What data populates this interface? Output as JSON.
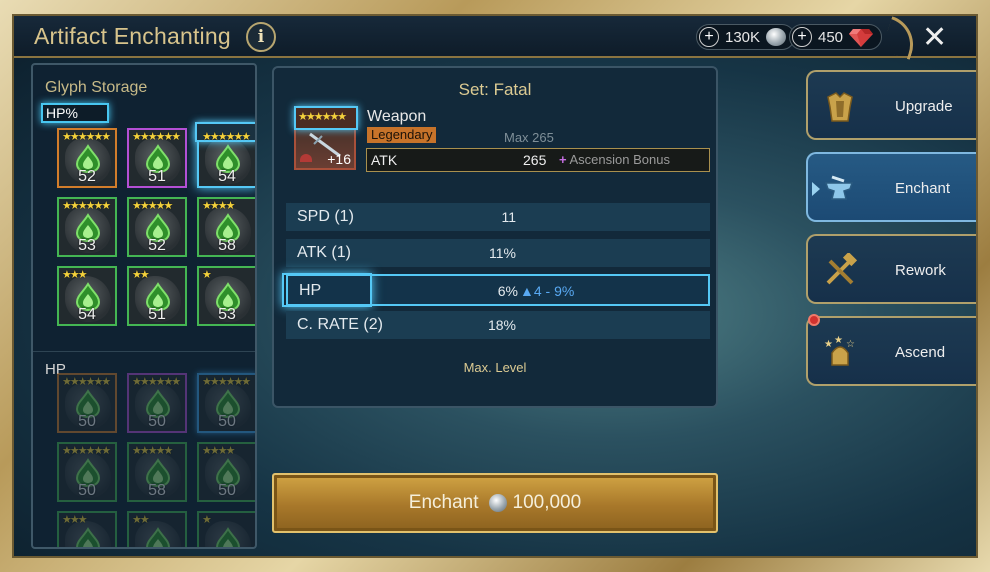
{
  "header": {
    "title": "Artifact Enchanting",
    "info_label": "i",
    "silver_amount": "130K",
    "gem_amount": "450",
    "close_label": "✕"
  },
  "glyph_storage": {
    "title": "Glyph Storage",
    "active_filter": "HP%",
    "hp_percent_glyphs": [
      {
        "level": "52",
        "stars": 6,
        "rarity": "orange"
      },
      {
        "level": "51",
        "stars": 6,
        "rarity": "purple"
      },
      {
        "level": "54",
        "stars": 6,
        "rarity": "blue",
        "selected": true
      },
      {
        "level": "53",
        "stars": 6,
        "rarity": "green"
      },
      {
        "level": "52",
        "stars": 5,
        "rarity": "green"
      },
      {
        "level": "58",
        "stars": 4,
        "rarity": "green"
      },
      {
        "level": "54",
        "stars": 3,
        "rarity": "green"
      },
      {
        "level": "51",
        "stars": 2,
        "rarity": "green"
      },
      {
        "level": "53",
        "stars": 1,
        "rarity": "green"
      }
    ],
    "hp_section_label": "HP",
    "hp_glyphs": [
      {
        "level": "50",
        "stars": 6,
        "rarity": "orange"
      },
      {
        "level": "50",
        "stars": 6,
        "rarity": "purple"
      },
      {
        "level": "50",
        "stars": 6,
        "rarity": "blue"
      },
      {
        "level": "50",
        "stars": 6,
        "rarity": "green"
      },
      {
        "level": "58",
        "stars": 5,
        "rarity": "green"
      },
      {
        "level": "50",
        "stars": 4,
        "rarity": "green"
      },
      {
        "level": "",
        "stars": 3,
        "rarity": "green"
      },
      {
        "level": "",
        "stars": 2,
        "rarity": "green"
      },
      {
        "level": "",
        "stars": 1,
        "rarity": "green"
      }
    ]
  },
  "artifact": {
    "set_label": "Set: Fatal",
    "name": "Weapon",
    "rarity": "Legendary",
    "level_label": "+16",
    "max_label": "Max 265",
    "main_stat": {
      "name": "ATK",
      "value": "265",
      "ascension_plus": "+",
      "ascension_label": "Ascension Bonus"
    },
    "substats": [
      {
        "name": "SPD (1)",
        "value": "11",
        "range": ""
      },
      {
        "name": "ATK (1)",
        "value": "11%",
        "range": ""
      },
      {
        "name": "HP",
        "value": "6%",
        "range": "▲4 - 9%"
      },
      {
        "name": "C. RATE (2)",
        "value": "18%",
        "range": ""
      }
    ],
    "max_level_label": "Max. Level"
  },
  "enchant_button": {
    "label": "Enchant",
    "cost": "100,000"
  },
  "tabs": [
    {
      "label": "Upgrade",
      "icon": "armor-icon",
      "active": false
    },
    {
      "label": "Enchant",
      "icon": "anvil-icon",
      "active": true
    },
    {
      "label": "Rework",
      "icon": "tools-icon",
      "active": false
    },
    {
      "label": "Ascend",
      "icon": "ascend-helmet-icon",
      "active": false
    }
  ],
  "colors": {
    "accent_gold": "#dccb93",
    "highlight_blue": "#55c8f5",
    "rarity_legendary": "#c7732a",
    "range_blue": "#59a9f2"
  }
}
